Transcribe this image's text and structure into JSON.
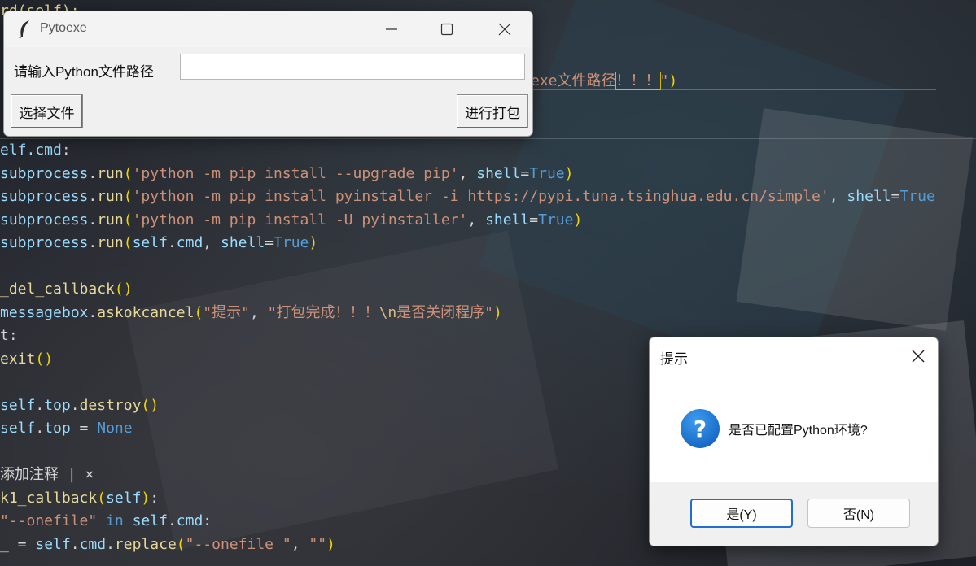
{
  "editor": {
    "lines": [
      [
        {
          "t": "rd(self):",
          "c": "fn"
        }
      ],
      [],
      [],
      [
        {
          "t": "exe文件路径",
          "c": "str"
        },
        {
          "t": "！！！",
          "c": "str",
          "box": true
        },
        {
          "t": "\"",
          "c": "str"
        },
        {
          "t": ")",
          "c": "paren"
        }
      ],
      [],
      [],
      [
        {
          "t": "elf.cmd",
          "c": "self"
        },
        {
          "t": ":",
          "c": "plain"
        }
      ],
      [
        {
          "t": "subprocess",
          "c": "param"
        },
        {
          "t": ".",
          "c": "plain"
        },
        {
          "t": "run",
          "c": "fn"
        },
        {
          "t": "(",
          "c": "paren"
        },
        {
          "t": "'python -m pip install --upgrade pip'",
          "c": "str"
        },
        {
          "t": ", ",
          "c": "plain"
        },
        {
          "t": "shell",
          "c": "param"
        },
        {
          "t": "=",
          "c": "plain"
        },
        {
          "t": "True",
          "c": "kw"
        },
        {
          "t": ")",
          "c": "paren"
        }
      ],
      [
        {
          "t": "subprocess",
          "c": "param"
        },
        {
          "t": ".",
          "c": "plain"
        },
        {
          "t": "run",
          "c": "fn"
        },
        {
          "t": "(",
          "c": "paren"
        },
        {
          "t": "'python -m pip install pyinstaller -i ",
          "c": "str"
        },
        {
          "t": "https://pypi.tuna.tsinghua.edu.cn/simple",
          "c": "url"
        },
        {
          "t": "'",
          "c": "str"
        },
        {
          "t": ", ",
          "c": "plain"
        },
        {
          "t": "shell",
          "c": "param"
        },
        {
          "t": "=",
          "c": "plain"
        },
        {
          "t": "True",
          "c": "kw"
        }
      ],
      [
        {
          "t": "subprocess",
          "c": "param"
        },
        {
          "t": ".",
          "c": "plain"
        },
        {
          "t": "run",
          "c": "fn"
        },
        {
          "t": "(",
          "c": "paren"
        },
        {
          "t": "'python -m pip install -U pyinstaller'",
          "c": "str"
        },
        {
          "t": ", ",
          "c": "plain"
        },
        {
          "t": "shell",
          "c": "param"
        },
        {
          "t": "=",
          "c": "plain"
        },
        {
          "t": "True",
          "c": "kw"
        },
        {
          "t": ")",
          "c": "paren"
        }
      ],
      [
        {
          "t": "subprocess",
          "c": "param"
        },
        {
          "t": ".",
          "c": "plain"
        },
        {
          "t": "run",
          "c": "fn"
        },
        {
          "t": "(",
          "c": "paren"
        },
        {
          "t": "self",
          "c": "self"
        },
        {
          "t": ".",
          "c": "plain"
        },
        {
          "t": "cmd",
          "c": "self"
        },
        {
          "t": ", ",
          "c": "plain"
        },
        {
          "t": "shell",
          "c": "param"
        },
        {
          "t": "=",
          "c": "plain"
        },
        {
          "t": "True",
          "c": "kw"
        },
        {
          "t": ")",
          "c": "paren"
        }
      ],
      [],
      [
        {
          "t": "_del_callback",
          "c": "fn"
        },
        {
          "t": "()",
          "c": "paren"
        }
      ],
      [
        {
          "t": "messagebox",
          "c": "param"
        },
        {
          "t": ".",
          "c": "plain"
        },
        {
          "t": "askokcancel",
          "c": "fn"
        },
        {
          "t": "(",
          "c": "paren"
        },
        {
          "t": "\"提示\"",
          "c": "str"
        },
        {
          "t": ", ",
          "c": "plain"
        },
        {
          "t": "\"打包完成！！！",
          "c": "str"
        },
        {
          "t": "\\n",
          "c": "esc"
        },
        {
          "t": "是否关闭程序\"",
          "c": "str"
        },
        {
          "t": ")",
          "c": "paren"
        }
      ],
      [
        {
          "t": "t:",
          "c": "plain"
        }
      ],
      [
        {
          "t": "exit",
          "c": "fn"
        },
        {
          "t": "()",
          "c": "paren"
        }
      ],
      [],
      [
        {
          "t": "self",
          "c": "self"
        },
        {
          "t": ".",
          "c": "plain"
        },
        {
          "t": "top",
          "c": "self"
        },
        {
          "t": ".",
          "c": "plain"
        },
        {
          "t": "destroy",
          "c": "fn"
        },
        {
          "t": "()",
          "c": "paren"
        }
      ],
      [
        {
          "t": "self",
          "c": "self"
        },
        {
          "t": ".",
          "c": "plain"
        },
        {
          "t": "top",
          "c": "self"
        },
        {
          "t": " = ",
          "c": "plain"
        },
        {
          "t": "None",
          "c": "kw"
        }
      ],
      [],
      [
        {
          "t": "添加注释 | ×",
          "c": "hint"
        }
      ],
      [
        {
          "t": "k1_callback",
          "c": "fn"
        },
        {
          "t": "(",
          "c": "paren"
        },
        {
          "t": "self",
          "c": "self"
        },
        {
          "t": ")",
          "c": "paren"
        },
        {
          "t": ":",
          "c": "plain"
        }
      ],
      [
        {
          "t": "\"--onefile\"",
          "c": "str"
        },
        {
          "t": " in ",
          "c": "kw"
        },
        {
          "t": "self",
          "c": "self"
        },
        {
          "t": ".",
          "c": "plain"
        },
        {
          "t": "cmd",
          "c": "self"
        },
        {
          "t": ":",
          "c": "plain"
        }
      ],
      [
        {
          "t": "_ = ",
          "c": "plain"
        },
        {
          "t": "self",
          "c": "self"
        },
        {
          "t": ".",
          "c": "plain"
        },
        {
          "t": "cmd",
          "c": "self"
        },
        {
          "t": ".",
          "c": "plain"
        },
        {
          "t": "replace",
          "c": "fn"
        },
        {
          "t": "(",
          "c": "paren"
        },
        {
          "t": "\"--onefile \"",
          "c": "str"
        },
        {
          "t": ", ",
          "c": "plain"
        },
        {
          "t": "\"\"",
          "c": "str"
        },
        {
          "t": ")",
          "c": "paren"
        }
      ]
    ]
  },
  "pytoexe": {
    "title": "Pytoexe",
    "path_label": "请输入Python文件路径",
    "path_value": "",
    "choose_button": "选择文件",
    "pack_button": "进行打包"
  },
  "dialog": {
    "title": "提示",
    "message": "是否已配置Python环境?",
    "yes_button": "是(Y)",
    "no_button": "否(N)",
    "icon": "question-icon"
  },
  "colors": {
    "dialog_accent": "#1f6fd1",
    "question_icon": "#1a78d6"
  }
}
